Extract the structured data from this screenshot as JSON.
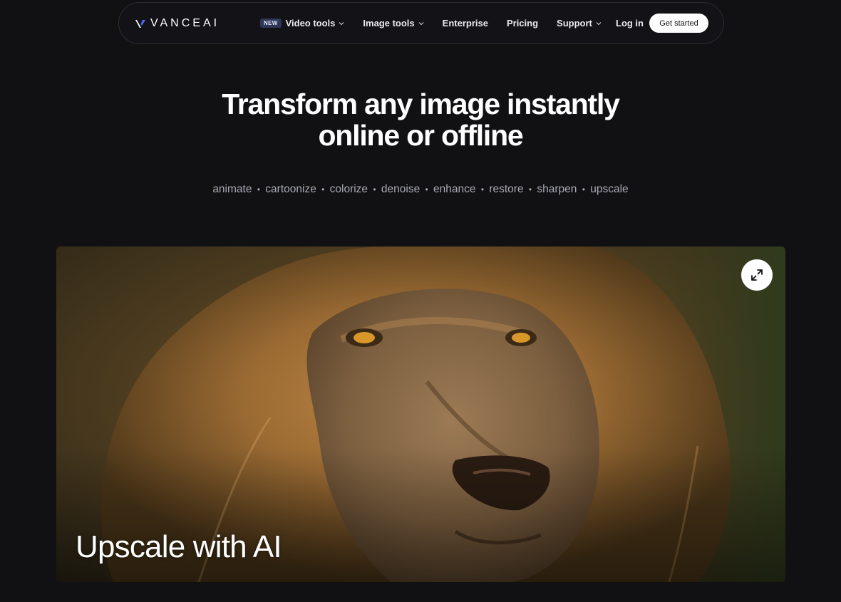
{
  "brand": {
    "name": "VANCEAI"
  },
  "nav": {
    "items": [
      {
        "label": "Video tools",
        "badge": "NEW",
        "has_dropdown": true
      },
      {
        "label": "Image tools",
        "has_dropdown": true
      },
      {
        "label": "Enterprise",
        "has_dropdown": false
      },
      {
        "label": "Pricing",
        "has_dropdown": false
      },
      {
        "label": "Support",
        "has_dropdown": true
      }
    ],
    "login_label": "Log in",
    "cta_label": "Get started"
  },
  "hero": {
    "title_line1": "Transform any image instantly",
    "title_line2": "online or offline",
    "features": [
      "animate",
      "cartoonize",
      "colorize",
      "denoise",
      "enhance",
      "restore",
      "sharpen",
      "upscale"
    ],
    "separator": "•"
  },
  "showcase": {
    "caption": "Upscale with AI",
    "expand_icon": "expand-arrows-icon",
    "image_subject": "lion close-up photo"
  },
  "colors": {
    "background": "#111114",
    "nav_background": "#131317",
    "badge_background": "#2e3756",
    "muted_text": "#a8a9b2",
    "cta_background": "#ffffff"
  }
}
